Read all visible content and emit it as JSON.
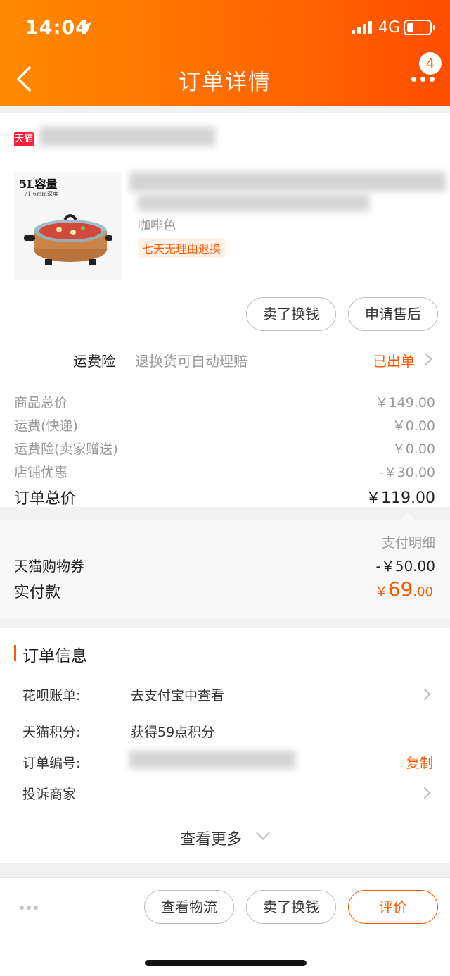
{
  "status_bar": {
    "time": "14:04",
    "network": "4G"
  },
  "nav": {
    "title": "订单详情",
    "badge_count": "4"
  },
  "shop": {
    "platform_tag": "天猫"
  },
  "product": {
    "image_caption": "5L容量",
    "image_subcaption": "71.6mm深度",
    "spec_partial": "咖啡色",
    "return_tag": "七天无理由退换"
  },
  "actions": {
    "sell_exchange": "卖了换钱",
    "after_sale": "申请售后"
  },
  "insurance": {
    "label": "运费险",
    "desc": "退换货可自动理赔",
    "status": "已出单"
  },
  "price_rows": [
    {
      "label": "商品总价",
      "value": "￥149.00"
    },
    {
      "label": "运费(快递)",
      "value": "￥0.00"
    },
    {
      "label": "运费险(卖家赠送)",
      "value": "￥0.00"
    },
    {
      "label": "店铺优惠",
      "value": "-￥30.00"
    }
  ],
  "order_total": {
    "label": "订单总价",
    "value": "￥119.00"
  },
  "payment": {
    "detail_label": "支付明细",
    "coupon_label": "天猫购物券",
    "coupon_value": "-￥50.00",
    "paid_label": "实付款",
    "paid_currency": "￥",
    "paid_int": "69",
    "paid_dec": ".00"
  },
  "order_info": {
    "title": "订单信息",
    "huabei_label": "花呗账单:",
    "huabei_value": "去支付宝中查看",
    "points_label": "天猫积分:",
    "points_value": "获得59点积分",
    "order_no_label": "订单编号:",
    "copy_label": "复制",
    "complain_label": "投诉商家",
    "see_more": "查看更多"
  },
  "bottom_actions": {
    "logistics": "查看物流",
    "sell_exchange": "卖了换钱",
    "review": "评价"
  },
  "colors": {
    "brand_orange": "#ff5a00",
    "tmall_red": "#ff1e3c",
    "header_from": "#ff8a00",
    "header_to": "#ff4e00"
  }
}
